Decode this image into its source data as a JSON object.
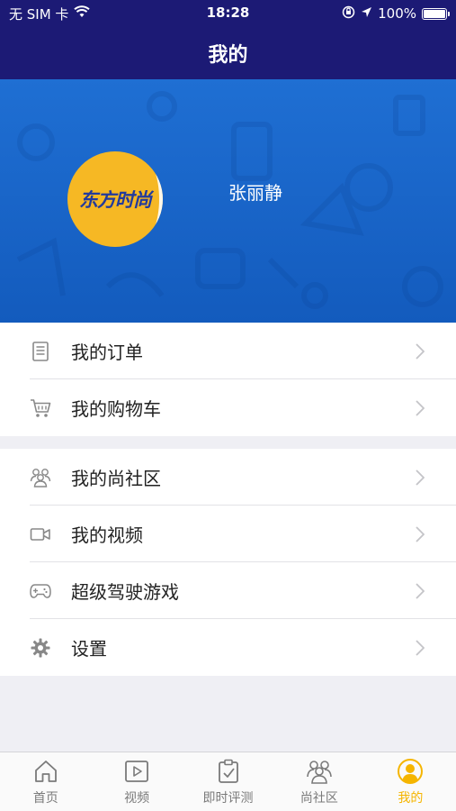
{
  "status_bar": {
    "carrier": "无 SIM 卡",
    "time": "18:28",
    "battery": "100%",
    "battery_level": 1.0
  },
  "header": {
    "title": "我的"
  },
  "profile": {
    "avatar_text": "东方时尚",
    "username": "张丽静"
  },
  "menu": {
    "group1": [
      {
        "label": "我的订单",
        "icon": "document-icon"
      },
      {
        "label": "我的购物车",
        "icon": "cart-icon"
      }
    ],
    "group2": [
      {
        "label": "我的尚社区",
        "icon": "community-icon"
      },
      {
        "label": "我的视频",
        "icon": "video-camera-icon"
      },
      {
        "label": "超级驾驶游戏",
        "icon": "gamepad-icon"
      },
      {
        "label": "设置",
        "icon": "gear-icon"
      }
    ]
  },
  "tabbar": {
    "tabs": [
      {
        "label": "首页",
        "icon": "home-icon"
      },
      {
        "label": "视频",
        "icon": "play-icon"
      },
      {
        "label": "即时评测",
        "icon": "clipboard-check-icon"
      },
      {
        "label": "尚社区",
        "icon": "people-icon"
      },
      {
        "label": "我的",
        "icon": "user-icon",
        "active": true
      }
    ]
  },
  "colors": {
    "nav_bg": "#1c1a75",
    "profile_bg": "#1863c6",
    "accent": "#f5b500",
    "avatar_bg": "#f6b824"
  }
}
